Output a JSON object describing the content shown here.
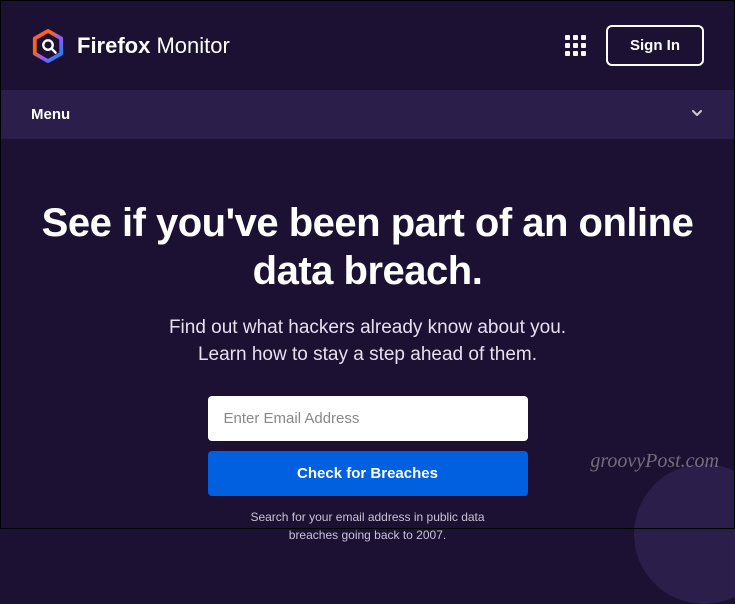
{
  "header": {
    "brand_bold": "Firefox",
    "brand_light": "Monitor",
    "sign_in": "Sign In"
  },
  "menu": {
    "label": "Menu"
  },
  "main": {
    "headline": "See if you've been part of an online data breach.",
    "subheadline_line1": "Find out what hackers already know about you.",
    "subheadline_line2": "Learn how to stay a step ahead of them.",
    "email_placeholder": "Enter Email Address",
    "check_button": "Check for Breaches",
    "helper_line1": "Search for your email address in public data",
    "helper_line2": "breaches going back to 2007."
  },
  "watermark": "groovyPost.com"
}
